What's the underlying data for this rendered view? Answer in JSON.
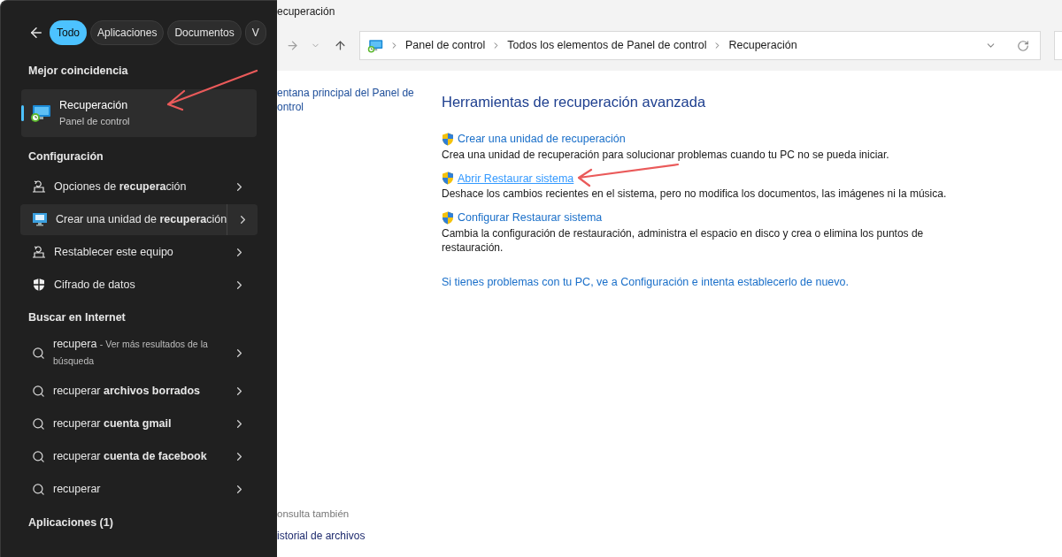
{
  "search_panel": {
    "filters": [
      {
        "label": "Todo",
        "selected": true
      },
      {
        "label": "Aplicaciones",
        "selected": false
      },
      {
        "label": "Documentos",
        "selected": false
      },
      {
        "label": "V",
        "selected": false
      }
    ],
    "best_match": {
      "heading": "Mejor coincidencia",
      "title": "Recuperación",
      "subtitle": "Panel de control",
      "selected": true
    },
    "settings": {
      "heading": "Configuración",
      "items": [
        {
          "kind": "reset",
          "label": "Opciones de **recupera**ción",
          "selected": false
        },
        {
          "kind": "monitor",
          "label": "Crear una unidad de **recupera**ción",
          "selected": true
        },
        {
          "kind": "reset",
          "label": "Restablecer este equipo",
          "selected": false
        },
        {
          "kind": "shield",
          "label": "Cifrado de datos",
          "selected": false
        }
      ]
    },
    "web": {
      "heading": "Buscar en Internet",
      "items": [
        {
          "query": "recupera",
          "hint": "- Ver más resultados de la búsqueda"
        },
        {
          "query": "recuperar **archivos borrados**"
        },
        {
          "query": "recuperar **cuenta gmail**"
        },
        {
          "query": "recuperar **cuenta de facebook**"
        },
        {
          "query": "recuperar"
        }
      ]
    },
    "apps_heading": "Aplicaciones (1)"
  },
  "window": {
    "title": "ecuperación",
    "breadcrumb": [
      "Panel de control",
      "Todos los elementos de Panel de control",
      "Recuperación"
    ],
    "sidebar": {
      "home_link_lines": [
        "entana principal del Panel de",
        "ontrol"
      ],
      "see_also_heading": "onsulta también",
      "see_also": [
        "istorial de archivos"
      ]
    },
    "heading": "Herramientas de recuperación avanzada",
    "tools": [
      {
        "link": "Crear una unidad de recuperación",
        "description": "Crea una unidad de recuperación para solucionar problemas cuando tu PC no se pueda iniciar.",
        "hovered": false
      },
      {
        "link": "Abrir Restaurar sistema",
        "description": "Deshace los cambios recientes en el sistema, pero no modifica los documentos, las imágenes ni la música.",
        "hovered": true
      },
      {
        "link": "Configurar Restaurar sistema",
        "description": "Cambia la configuración de restauración, administra el espacio en disco y crea o elimina los puntos de restauración.",
        "hovered": false
      }
    ],
    "footer_link": "Si tienes problemas con tu PC, ve a Configuración e intenta establecerlo de nuevo."
  }
}
